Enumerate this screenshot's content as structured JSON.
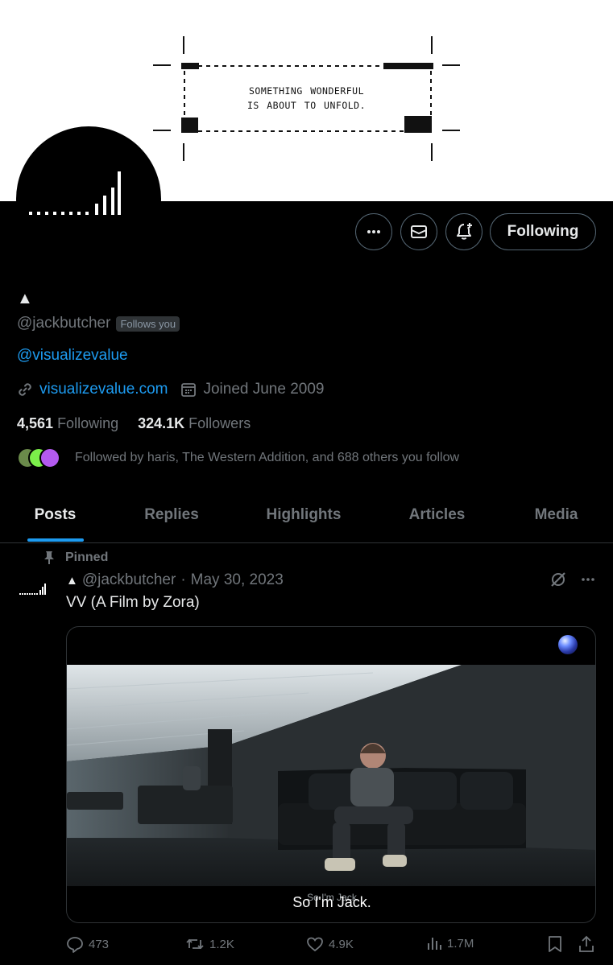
{
  "banner": {
    "line1": "SOMETHING WONDERFUL",
    "line2": "IS ABOUT TO UNFOLD."
  },
  "profile": {
    "display_name": "▲",
    "handle": "@jackbutcher",
    "follows_you": "Follows you",
    "bio": "@visualizevalue",
    "website": "visualizevalue.com",
    "joined": "Joined June 2009",
    "following_count": "4,561",
    "following_label": "Following",
    "followers_count": "324.1K",
    "followers_label": "Followers",
    "followed_by": "Followed by haris, The Western Addition, and 688 others you follow"
  },
  "actions": {
    "follow_label": "Following"
  },
  "tabs": [
    {
      "label": "Posts",
      "active": true
    },
    {
      "label": "Replies",
      "active": false
    },
    {
      "label": "Highlights",
      "active": false
    },
    {
      "label": "Articles",
      "active": false
    },
    {
      "label": "Media",
      "active": false
    }
  ],
  "post": {
    "pinned_label": "Pinned",
    "author_mark": "▲",
    "handle": "@jackbutcher",
    "separator": "·",
    "date": "May 30, 2023",
    "text": "VV (A Film by Zora)",
    "caption": "So I'm Jack.",
    "caption_ghost": "So I'm Jack",
    "replies": "473",
    "reposts": "1.2K",
    "likes": "4.9K",
    "views": "1.7M"
  },
  "colors": {
    "accent": "#1d9bf0",
    "muted": "#71767b",
    "border": "#2f3336"
  }
}
